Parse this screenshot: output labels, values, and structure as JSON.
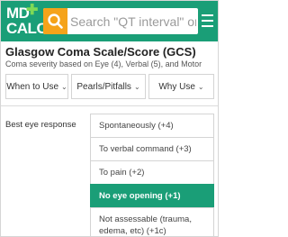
{
  "header": {
    "logo_line1": "MD",
    "logo_line2": "CALC",
    "search_placeholder": "Search \"QT interval\" or",
    "search_icon": "search-icon",
    "menu_icon": "menu-icon"
  },
  "calc": {
    "title": "Glasgow Coma Scale/Score (GCS)",
    "subtitle": "Coma severity based on Eye (4), Verbal (5), and Motor"
  },
  "tabs": [
    {
      "label": "When to Use"
    },
    {
      "label": "Pearls/Pitfalls"
    },
    {
      "label": "Why Use"
    }
  ],
  "question": {
    "label": "Best eye response",
    "options": [
      {
        "label": "Spontaneously (+4)",
        "selected": false
      },
      {
        "label": "To verbal command (+3)",
        "selected": false
      },
      {
        "label": "To pain (+2)",
        "selected": false
      },
      {
        "label": "No eye opening (+1)",
        "selected": true
      },
      {
        "label": "Not assessable (trauma, edema, etc) (+1c)",
        "selected": false
      }
    ]
  },
  "colors": {
    "brand_green": "#1a9e77",
    "search_orange": "#f5a31a",
    "logo_plus_green": "#7ed957"
  }
}
